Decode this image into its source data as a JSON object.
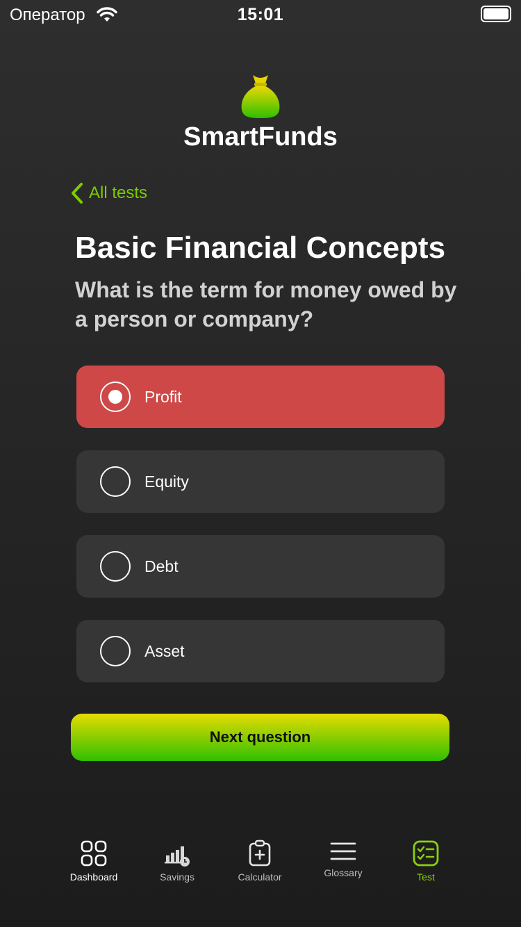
{
  "status_bar": {
    "carrier": "Оператор",
    "time": "15:01"
  },
  "app": {
    "title": "SmartFunds",
    "icon": "money-bag-icon"
  },
  "nav": {
    "back_label": "All tests"
  },
  "test": {
    "title": "Basic Financial Concepts",
    "question": "What is the term for money owed by a person or company?"
  },
  "options": [
    {
      "label": "Profit",
      "selected": true
    },
    {
      "label": "Equity",
      "selected": false
    },
    {
      "label": "Debt",
      "selected": false
    },
    {
      "label": "Asset",
      "selected": false
    }
  ],
  "actions": {
    "next_label": "Next question"
  },
  "tabs": [
    {
      "label": "Dashboard",
      "icon": "grid-icon",
      "active": false
    },
    {
      "label": "Savings",
      "icon": "bar-chart-clock-icon",
      "active": false
    },
    {
      "label": "Calculator",
      "icon": "clipboard-plus-icon",
      "active": false
    },
    {
      "label": "Glossary",
      "icon": "menu-lines-icon",
      "active": false
    },
    {
      "label": "Test",
      "icon": "checklist-icon",
      "active": true
    }
  ],
  "colors": {
    "accent_green": "#7ccc00",
    "selected_option": "#ce4848",
    "option_bg": "#363636",
    "button_gradient_top": "#e6dc00",
    "button_gradient_bottom": "#2fc000"
  }
}
